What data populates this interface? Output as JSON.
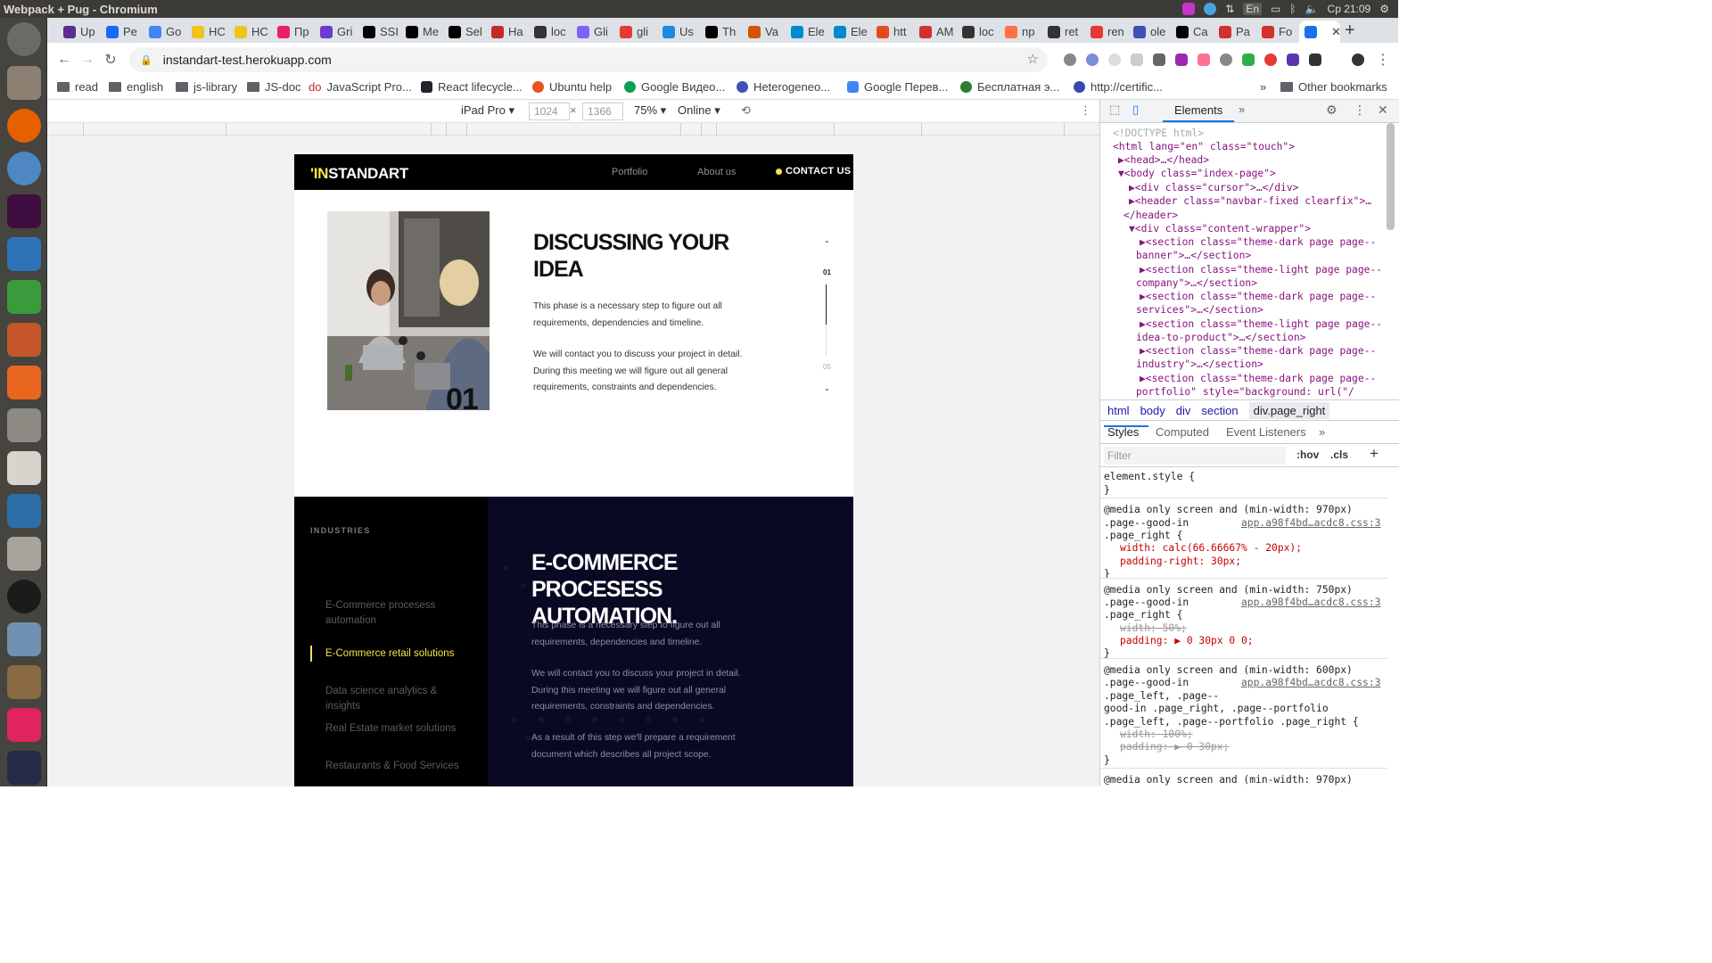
{
  "os": {
    "window_title": "Webpack + Pug - Chromium",
    "clock": "Ср 21:09",
    "keyboard_layout": "En"
  },
  "browser": {
    "tabs": [
      "Up",
      "Pe",
      "Go",
      "HC",
      "HC",
      "Пр",
      "Gri",
      "SSI",
      "Me",
      "Sel",
      "Ha",
      "loc",
      "Gli",
      "gli",
      "Us",
      "Th",
      "Va",
      "Ele",
      "Ele",
      "htt",
      "AM",
      "loc",
      "np",
      "ret",
      "ren",
      "ole",
      "Ca",
      "Pa",
      "Fo",
      ""
    ],
    "url": "instandart-test.herokuapp.com",
    "bookmarks": [
      {
        "label": "read",
        "type": "folder"
      },
      {
        "label": "english",
        "type": "folder"
      },
      {
        "label": "js-library",
        "type": "folder"
      },
      {
        "label": "JS-doc",
        "type": "folder"
      },
      {
        "label": "JavaScript Pro...",
        "type": "site",
        "prefix": "do"
      },
      {
        "label": "React lifecycle...",
        "type": "site"
      },
      {
        "label": "Ubuntu help",
        "type": "site"
      },
      {
        "label": "Google Видео...",
        "type": "site"
      },
      {
        "label": "Heterogeneo...",
        "type": "site"
      },
      {
        "label": "Google Перев...",
        "type": "site"
      },
      {
        "label": "Бесплатная э...",
        "type": "site"
      },
      {
        "label": "http://certific...",
        "type": "site"
      }
    ],
    "other_bookmarks": "Other bookmarks",
    "more_bookmarks": "»"
  },
  "device_toolbar": {
    "device": "iPad Pro",
    "width": "1024",
    "height": "1366",
    "times": "×",
    "zoom": "75%",
    "network": "Online"
  },
  "site": {
    "logo_prefix": "'IN",
    "logo_rest": "STANDART",
    "nav": {
      "portfolio": "Portfolio",
      "about": "About us",
      "contact": "CONTACT US"
    },
    "idea": {
      "photo_number": "01",
      "title": "DISCUSSING YOUR IDEA",
      "p1": "This phase is a necessary step to figure out all requirements, dependencies and timeline.",
      "p2": "We will contact you to discuss your project in detail. During this meeting we will figure out all general requirements, constraints and dependencies.",
      "step_current": "01",
      "step_total": "05"
    },
    "industries": {
      "label": "INDUSTRIES",
      "items": [
        "E-Commerce procesess automation",
        "E-Commerce retail solutions",
        "Data science analytics & insights",
        "Real Estate market solutions",
        "Restaurants & Food Services"
      ],
      "active_index": 1,
      "title": "E-COMMERCE PROCESESS AUTOMATION.",
      "p1": "This phase is a necessary step to figure out all requirements, dependencies and timeline.",
      "p2": "We will contact you to discuss your project in detail. During this meeting we will figure out all general requirements, constraints and dependencies.",
      "p3": "As a result of this step we'll prepare a requirement document which describes all project scope."
    }
  },
  "devtools": {
    "panel": "Elements",
    "more": "»",
    "dom": [
      "<!DOCTYPE html>",
      "<html lang=\"en\" class=\"touch\">",
      "▶<head>…</head>",
      "▼<body class=\"index-page\">",
      "▶<div class=\"cursor\">…</div>",
      "▶<header class=\"navbar-fixed clearfix\">…",
      "</header>",
      "▼<div class=\"content-wrapper\">",
      "▶<section class=\"theme-dark page page--",
      "banner\">…</section>",
      "▶<section class=\"theme-light page page--",
      "company\">…</section>",
      "▶<section class=\"theme-dark page page--",
      "services\">…</section>",
      "▶<section class=\"theme-light page page--",
      "idea-to-product\">…</section>",
      "▶<section class=\"theme-dark page page--",
      "industry\">…</section>",
      "▶<section class=\"theme-dark page page--",
      "portfolio\" style=\"background: url(\"/",
      "assets/img/bgs/portfolio/"
    ],
    "breadcrumbs": [
      "html",
      "body",
      "div",
      "section",
      "div.page_right"
    ],
    "style_tabs": [
      "Styles",
      "Computed",
      "Event Listeners",
      "»"
    ],
    "filter_placeholder": "Filter",
    "hov": ":hov",
    "cls": ".cls",
    "plus": "+",
    "styles": [
      "element.style {",
      "}",
      "@media only screen and (min-width: 970px)",
      ".page--good-in",
      ".page_right {",
      "width: calc(66.66667% - 20px);",
      "padding-right: 30px;",
      "}",
      "@media only screen and (min-width: 750px)",
      ".page--good-in",
      ".page_right {",
      "width: 50%;",
      "padding: ▶ 0 30px 0 0;",
      "}",
      "@media only screen and (min-width: 600px)",
      ".page--good-in",
      ".page_left, .page--",
      "good-in .page_right, .page--portfolio",
      ".page_left, .page--portfolio .page_right {",
      "width: 100%;",
      "padding: ▶ 0 30px;",
      "}",
      "@media only screen and (min-width: 970px)"
    ],
    "source": "app.a98f4bd…acdc8.css:3"
  },
  "colors": {
    "accent": "#f9e547",
    "dark": "#000000",
    "navy": "#0a0923"
  }
}
